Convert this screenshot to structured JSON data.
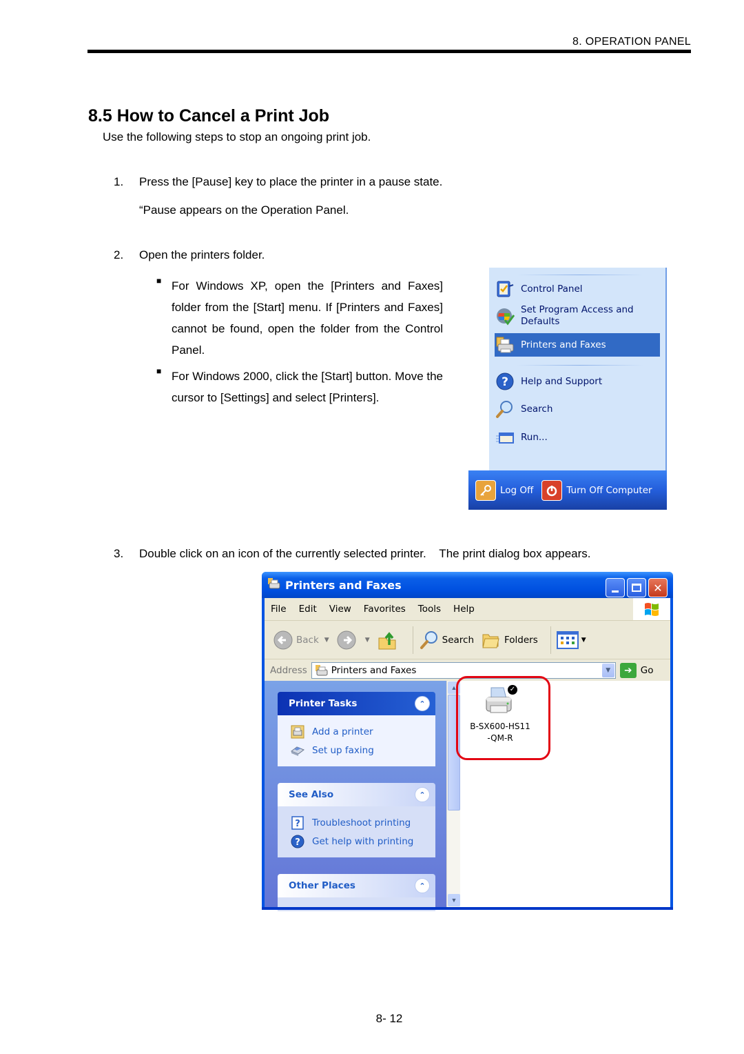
{
  "header": {
    "running_title": "8. OPERATION PANEL"
  },
  "section": {
    "title": "8.5 How to Cancel a Print Job",
    "intro": "Use the following steps to stop an ongoing print job."
  },
  "steps": [
    {
      "num": "1.",
      "text": "Press the [Pause] key to place the printer in a pause state.",
      "sub": "“Pause appears on the Operation Panel."
    },
    {
      "num": "2.",
      "text": "Open the printers folder."
    },
    {
      "num": "3.",
      "text": "Double click on an icon of the currently selected printer.    The print dialog box appears."
    }
  ],
  "bullets": [
    "For Windows XP, open the [Printers and Faxes] folder from the [Start] menu.   If [Printers and Faxes] cannot be found, open the folder from the Control Panel.",
    "For Windows 2000, click the [Start] button. Move the cursor to [Settings] and select [Printers]."
  ],
  "start_menu": {
    "items": [
      {
        "label": "Control Panel",
        "icon": "control-panel-icon"
      },
      {
        "label": "Set Program Access and Defaults",
        "icon": "program-access-icon"
      },
      {
        "label": "Printers and Faxes",
        "icon": "printer-icon",
        "selected": true
      },
      {
        "label": "Help and Support",
        "icon": "help-icon"
      },
      {
        "label": "Search",
        "icon": "search-icon"
      },
      {
        "label": "Run...",
        "icon": "run-icon"
      }
    ],
    "bottom": {
      "log_off": "Log Off",
      "turn_off": "Turn Off Computer"
    }
  },
  "explorer": {
    "title": "Printers and Faxes",
    "menu": [
      "File",
      "Edit",
      "View",
      "Favorites",
      "Tools",
      "Help"
    ],
    "toolbar": {
      "back": "Back",
      "search": "Search",
      "folders": "Folders"
    },
    "address": {
      "label": "Address",
      "value": "Printers and Faxes",
      "go": "Go"
    },
    "panels": [
      {
        "title": "Printer Tasks",
        "links": [
          "Add a printer",
          "Set up faxing"
        ]
      },
      {
        "title": "See Also",
        "links": [
          "Troubleshoot printing",
          "Get help with printing"
        ]
      },
      {
        "title": "Other Places",
        "links": []
      }
    ],
    "printer": {
      "name_line1": "B-SX600-HS11",
      "name_line2": "-QM-R",
      "default": true
    }
  },
  "footer": {
    "page_number": "8- 12"
  }
}
